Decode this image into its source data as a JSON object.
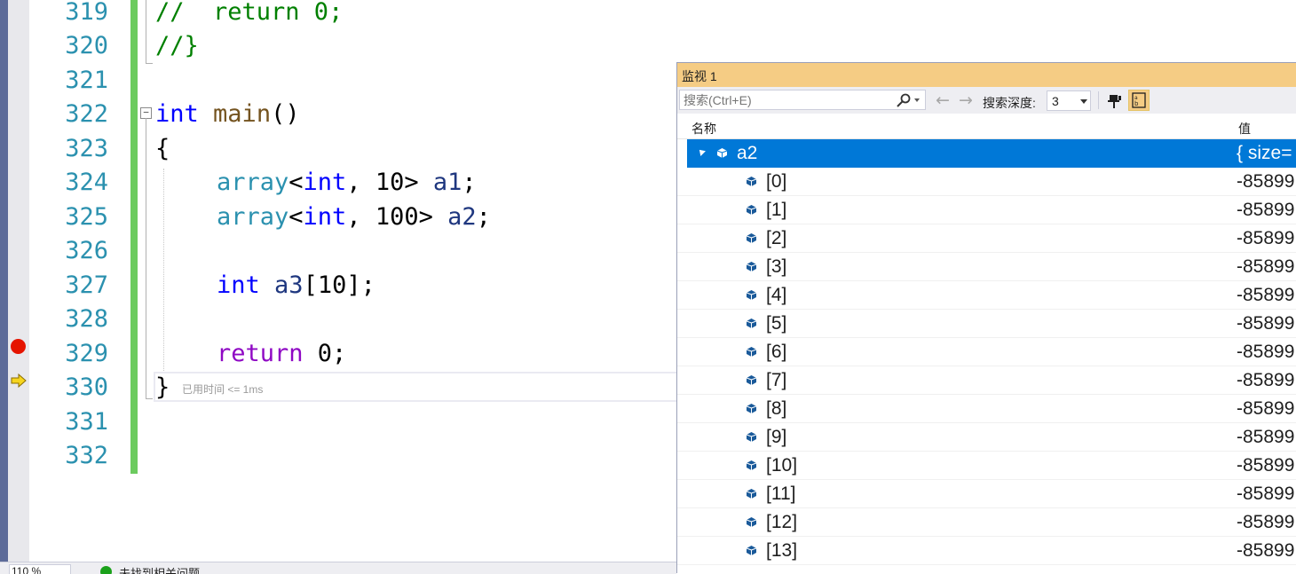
{
  "editor": {
    "lines": [
      {
        "no": "319"
      },
      {
        "no": "320"
      },
      {
        "no": "321"
      },
      {
        "no": "322"
      },
      {
        "no": "323"
      },
      {
        "no": "324"
      },
      {
        "no": "325"
      },
      {
        "no": "326"
      },
      {
        "no": "327"
      },
      {
        "no": "328"
      },
      {
        "no": "329"
      },
      {
        "no": "330"
      },
      {
        "no": "331"
      },
      {
        "no": "332"
      }
    ],
    "code": {
      "l319": "//  return 0;",
      "l320": "//}",
      "l322_kw": "int",
      "l322_fn": "main",
      "l322_rest": "()",
      "l323": "{",
      "l324_ty": "array",
      "l324_a": "<",
      "l324_kw": "int",
      "l324_b": ", 10> ",
      "l324_var": "a1",
      "l324_end": ";",
      "l325_ty": "array",
      "l325_a": "<",
      "l325_kw": "int",
      "l325_b": ", 100> ",
      "l325_var": "a2",
      "l325_end": ";",
      "l327_kw": "int",
      "l327_var": "a3",
      "l327_rest": "[10];",
      "l329_kw": "return",
      "l329_rest": " 0;",
      "l330": "}"
    },
    "elapsed": "已用时间 <= 1ms",
    "zoom": "110 %",
    "issues": "未找到相关问题"
  },
  "watch": {
    "title": "监视 1",
    "search_placeholder": "搜索(Ctrl+E)",
    "depth_label": "搜索深度:",
    "depth_value": "3",
    "col_name": "名称",
    "col_value": "值",
    "root": {
      "name": "a2",
      "value": "{ size="
    },
    "items": [
      {
        "name": "[0]",
        "value": "-85899"
      },
      {
        "name": "[1]",
        "value": "-85899"
      },
      {
        "name": "[2]",
        "value": "-85899"
      },
      {
        "name": "[3]",
        "value": "-85899"
      },
      {
        "name": "[4]",
        "value": "-85899"
      },
      {
        "name": "[5]",
        "value": "-85899"
      },
      {
        "name": "[6]",
        "value": "-85899"
      },
      {
        "name": "[7]",
        "value": "-85899"
      },
      {
        "name": "[8]",
        "value": "-85899"
      },
      {
        "name": "[9]",
        "value": "-85899"
      },
      {
        "name": "[10]",
        "value": "-85899"
      },
      {
        "name": "[11]",
        "value": "-85899"
      },
      {
        "name": "[12]",
        "value": "-85899"
      },
      {
        "name": "[13]",
        "value": "-85899"
      }
    ]
  }
}
